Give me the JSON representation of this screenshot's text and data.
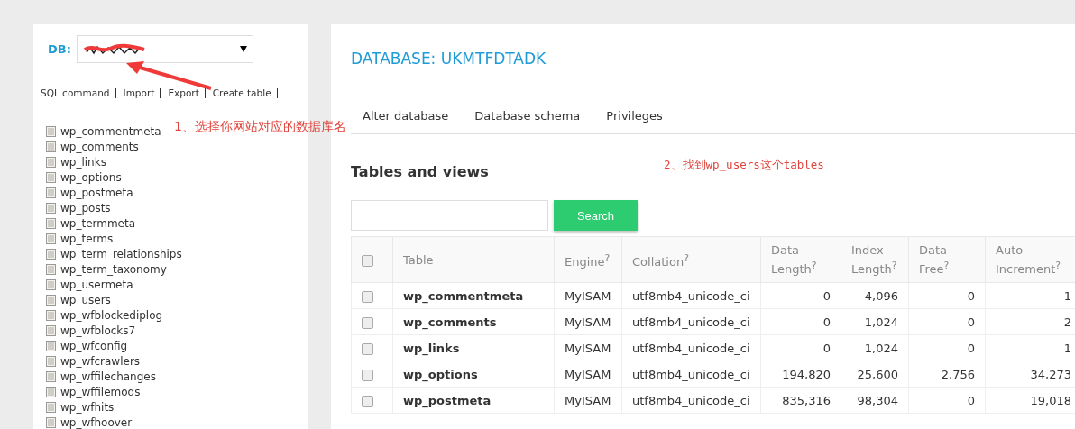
{
  "sidebar": {
    "db_label": "DB:",
    "links": [
      "SQL command",
      "Import",
      "Export",
      "Create table"
    ],
    "tables": [
      "wp_commentmeta",
      "wp_comments",
      "wp_links",
      "wp_options",
      "wp_postmeta",
      "wp_posts",
      "wp_termmeta",
      "wp_terms",
      "wp_term_relationships",
      "wp_term_taxonomy",
      "wp_usermeta",
      "wp_users",
      "wp_wfblockediplog",
      "wp_wfblocks7",
      "wp_wfconfig",
      "wp_wfcrawlers",
      "wp_wffilechanges",
      "wp_wffilemods",
      "wp_wfhits",
      "wp_wfhoover"
    ]
  },
  "main": {
    "title": "DATABASE: UKMTFDTADK",
    "tabs": [
      "Alter database",
      "Database schema",
      "Privileges"
    ],
    "section_title": "Tables and views",
    "search_button": "Search",
    "table": {
      "select_all_checked": false,
      "columns": [
        "Table",
        "Engine$^{?}$",
        "Collation$^{?}$",
        "Data Length$^{?}$",
        "Index Length$^{?}$",
        "Data Free$^{?}$",
        "Auto Increment$^{?}$"
      ],
      "rows": [
        {
          "checked": false,
          "cells": [
            "wp_commentmeta",
            "MyISAM",
            "utf8mb4_unicode_ci",
            "0",
            "4,096",
            "0",
            "1"
          ]
        },
        {
          "checked": false,
          "cells": [
            "wp_comments",
            "MyISAM",
            "utf8mb4_unicode_ci",
            "0",
            "1,024",
            "0",
            "2"
          ]
        },
        {
          "checked": false,
          "cells": [
            "wp_links",
            "MyISAM",
            "utf8mb4_unicode_ci",
            "0",
            "1,024",
            "0",
            "1"
          ]
        },
        {
          "checked": false,
          "cells": [
            "wp_options",
            "MyISAM",
            "utf8mb4_unicode_ci",
            "194,820",
            "25,600",
            "2,756",
            "34,273"
          ]
        },
        {
          "checked": false,
          "cells": [
            "wp_postmeta",
            "MyISAM",
            "utf8mb4_unicode_ci",
            "835,316",
            "98,304",
            "0",
            "19,018"
          ]
        }
      ]
    }
  },
  "annotations": [
    "1、选择你网站对应的数据库名",
    "2、找到wp_users这个tables"
  ]
}
